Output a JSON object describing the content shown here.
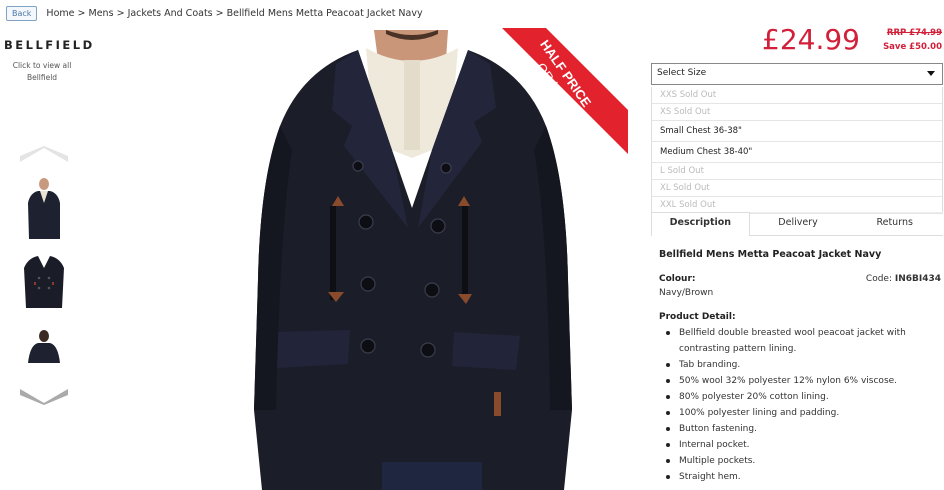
{
  "nav": {
    "back_label": "Back",
    "breadcrumb": [
      "Home",
      "Mens",
      "Jackets And Coats",
      "Bellfield Mens Metta Peacoat Jacket Navy"
    ],
    "separator": ">"
  },
  "brand": {
    "logo_text": "BELLFIELD",
    "link_line1": "Click to view all",
    "link_line2": "Bellfield"
  },
  "gallery": {
    "thumbnails": [
      {
        "icon": "model-front-thumbnail"
      },
      {
        "icon": "jacket-flat-thumbnail"
      },
      {
        "icon": "model-back-thumbnail"
      }
    ],
    "ribbon_line1": "HALF PRICE",
    "ribbon_line2": "OR LESS",
    "ribbon_color": "#e2232e"
  },
  "pricing": {
    "price": "£24.99",
    "rrp": "RRP £74.99",
    "save": "Save £50.00",
    "accent": "#d3203a"
  },
  "size_select": {
    "placeholder": "Select Size",
    "options": [
      {
        "label": "XXS Sold Out",
        "available": false
      },
      {
        "label": "XS Sold Out",
        "available": false
      },
      {
        "label": "Small Chest 36-38\"",
        "available": true
      },
      {
        "label": "Medium Chest 38-40\"",
        "available": true
      },
      {
        "label": "L Sold Out",
        "available": false
      },
      {
        "label": "XL Sold Out",
        "available": false
      },
      {
        "label": "XXL Sold Out",
        "available": false
      }
    ]
  },
  "tabs": [
    "Description",
    "Delivery",
    "Returns"
  ],
  "description": {
    "title": "Bellfield Mens Metta Peacoat Jacket Navy",
    "colour_label": "Colour:",
    "colour_value": "Navy/Brown",
    "code_label": "Code:",
    "code_value": "IN6BI434",
    "detail_heading": "Product Detail:",
    "details": [
      "Bellfield double breasted wool peacoat jacket with contrasting pattern lining.",
      "Tab branding.",
      "50% wool 32% polyester 12% nylon 6% viscose.",
      "80% polyester 20% cotton lining.",
      "100% polyester lining and padding.",
      "Button fastening.",
      "Internal pocket.",
      "Multiple pockets.",
      "Straight hem."
    ]
  }
}
